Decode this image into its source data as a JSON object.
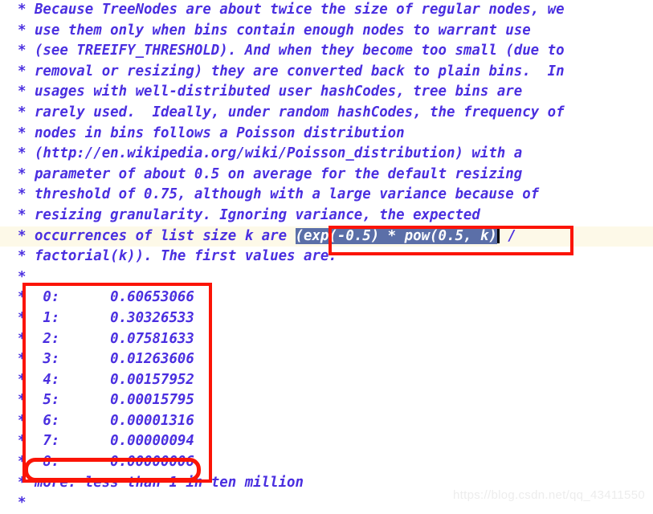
{
  "editor": {
    "lines": [
      {
        "text": "* Because TreeNodes are about twice the size of regular nodes, we",
        "current": false
      },
      {
        "text": "* use them only when bins contain enough nodes to warrant use",
        "current": false
      },
      {
        "text": "* (see TREEIFY_THRESHOLD). And when they become too small (due to",
        "current": false
      },
      {
        "text": "* removal or resizing) they are converted back to plain bins.  In",
        "current": false
      },
      {
        "text": "* usages with well-distributed user hashCodes, tree bins are",
        "current": false
      },
      {
        "text": "* rarely used.  Ideally, under random hashCodes, the frequency of",
        "current": false
      },
      {
        "text": "* nodes in bins follows a Poisson distribution",
        "current": false
      },
      {
        "text": "* (http://en.wikipedia.org/wiki/Poisson_distribution) with a",
        "current": false
      },
      {
        "text": "* parameter of about 0.5 on average for the default resizing",
        "current": false
      },
      {
        "text": "* threshold of 0.75, although with a large variance because of",
        "current": false
      },
      {
        "text": "* resizing granularity. Ignoring variance, the expected",
        "current": false
      }
    ],
    "selection_line": {
      "prefix": "* occurrences of list size k are ",
      "selected_text": "(exp(-0.5) * pow(0.5, k)",
      "suffix": " /",
      "current": true
    },
    "lines_after": [
      {
        "text": "* factorial(k)). The first values are:",
        "current": false
      },
      {
        "text": "*",
        "current": false
      }
    ],
    "poisson_table": [
      {
        "key": "0:",
        "value": "0.60653066"
      },
      {
        "key": "1:",
        "value": "0.30326533"
      },
      {
        "key": "2:",
        "value": "0.07581633"
      },
      {
        "key": "3:",
        "value": "0.01263606"
      },
      {
        "key": "4:",
        "value": "0.00157952"
      },
      {
        "key": "5:",
        "value": "0.00015795"
      },
      {
        "key": "6:",
        "value": "0.00001316"
      },
      {
        "key": "7:",
        "value": "0.00000094"
      },
      {
        "key": "8:",
        "value": "0.00000006"
      }
    ],
    "lines_tail": [
      {
        "text": "* more: less than 1 in ten million",
        "current": false
      },
      {
        "text": "*",
        "current": false
      }
    ]
  },
  "annotations": {
    "selection_box_label": "expression-highlight-box",
    "table_box_label": "poisson-table-box",
    "row8_box_label": "poisson-row-8-box",
    "color": "#fb1406"
  },
  "watermark": {
    "text": "https://blog.csdn.net/qq_43411550"
  },
  "colors": {
    "code_text": "#4a2fe0",
    "selection_bg": "#5b6fa8",
    "selection_fg": "#ffffff",
    "current_line_bg": "#fdf9e8",
    "annotation_red": "#fb1406",
    "watermark": "#ededed",
    "background": "#ffffff"
  }
}
